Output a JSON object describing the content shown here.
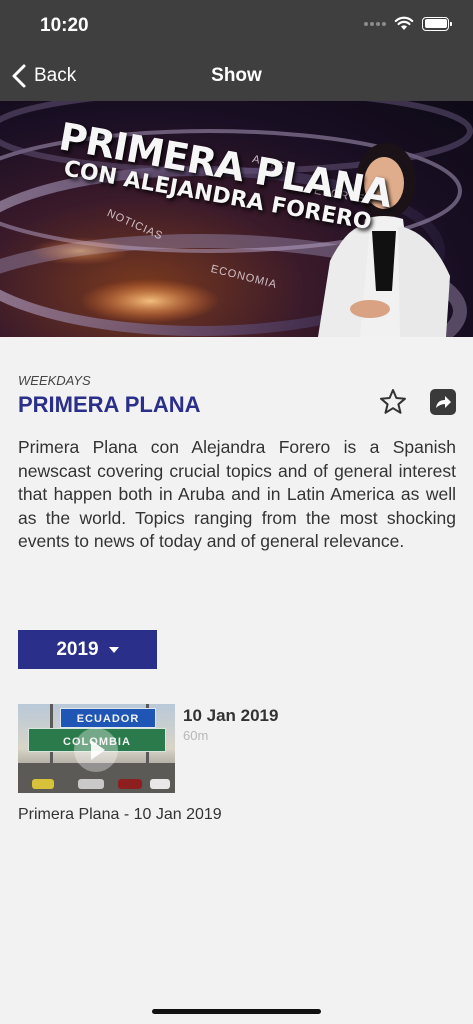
{
  "status_bar": {
    "time": "10:20"
  },
  "nav": {
    "back_label": "Back",
    "title": "Show"
  },
  "hero": {
    "title_line1": "PRIMERA PLANA",
    "title_line2": "CON ALEJANDRA FORERO",
    "words": [
      "NOTICIAS",
      "ECONOMIA",
      "ARTE",
      "DEPORTES"
    ]
  },
  "show": {
    "schedule": "WEEKDAYS",
    "title": "PRIMERA PLANA",
    "description": "Primera Plana con Alejandra Forero is a Spanish newscast covering crucial topics and of general interest that happen both in Aruba and in Latin America as well as the world. Topics ranging from the most shocking events to news of today and of general relevance."
  },
  "year_selector": {
    "selected": "2019"
  },
  "episodes": [
    {
      "date": "10 Jan 2019",
      "duration": "60m",
      "caption": "Primera Plana - 10 Jan 2019",
      "thumbnail_signs": [
        "ECUADOR",
        "COLOMBIA"
      ]
    }
  ],
  "colors": {
    "bar_background": "#3f3f3f",
    "accent": "#2a2f8a",
    "page_background": "#f2f2f2"
  },
  "icons": [
    "back-chevron-icon",
    "wifi-icon",
    "battery-icon",
    "star-icon",
    "share-icon",
    "play-icon",
    "caret-down-icon"
  ]
}
